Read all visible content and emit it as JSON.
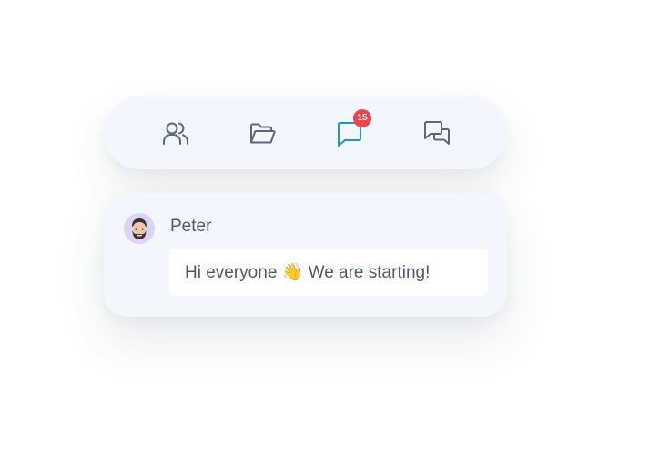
{
  "toolbar": {
    "tools": [
      {
        "name": "people",
        "icon": "users-icon"
      },
      {
        "name": "files",
        "icon": "folder-open-icon"
      },
      {
        "name": "chat",
        "icon": "chat-bubble-icon",
        "active": true,
        "badge": "15"
      },
      {
        "name": "conversations",
        "icon": "chat-bubbles-icon"
      }
    ]
  },
  "message": {
    "sender": "Peter",
    "avatar": "avatar-peter",
    "text": "Hi everyone 👋 We are starting!"
  },
  "colors": {
    "icon": "#5c6680",
    "active_icon": "#1a9bc4",
    "badge": "#f0434b",
    "panel": "#f3f7fd",
    "text": "#4f596e"
  }
}
